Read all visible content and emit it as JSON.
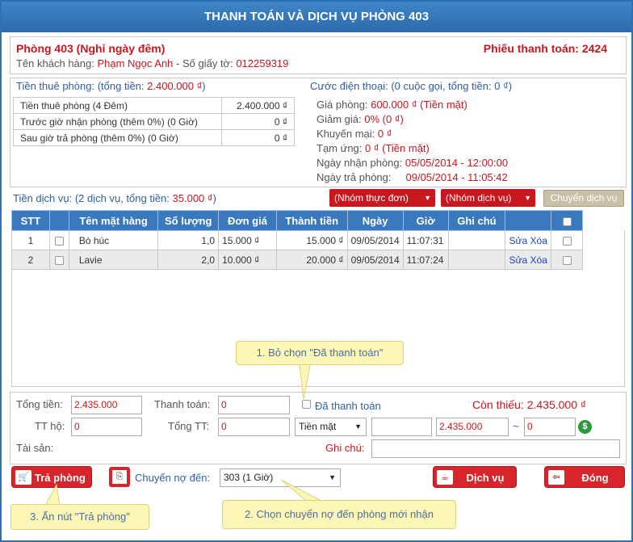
{
  "window": {
    "title": "THANH TOÁN VÀ DỊCH VỤ PHÒNG 403"
  },
  "header": {
    "room": "Phòng 403 (Nghỉ ngày đêm)",
    "bill_label": "Phiếu thanh toán: 2424",
    "customer_label": "Tên khách hàng: ",
    "customer_name": "Phạm Ngọc Anh",
    "id_label": " - Số giấy tờ: ",
    "id_number": "012259319"
  },
  "rent": {
    "heading_prefix": "Tiền thuê phòng: (tổng tiền: ",
    "heading_total": "2.400.000 ₫",
    "heading_suffix": ")",
    "rows": [
      {
        "label": "Tiền thuê phòng (4 Đêm)",
        "value": "2.400.000 ₫"
      },
      {
        "label": "Trước giờ nhận phòng (thêm 0%) (0 Giờ)",
        "value": "0 ₫"
      },
      {
        "label": "Sau giờ trả phòng (thêm 0%) (0 Giờ)",
        "value": "0 ₫"
      }
    ]
  },
  "phone": {
    "heading": "Cước điện thoại: (0 cuộc gọi, tổng tiền: 0 ₫)",
    "room_price_label": "Giá phòng: ",
    "room_price": "600.000 ₫ (Tiền mặt)",
    "discount_label": "Giảm giá: ",
    "discount": "0% (0 ₫)",
    "promo_label": "Khuyến mại: ",
    "promo": "0 ₫",
    "advance_label": "Tạm ứng: ",
    "advance": "0 ₫ (Tiền mặt)",
    "checkin_label": "Ngày nhận phòng: ",
    "checkin": "05/05/2014 - 12:00:00",
    "checkout_label": "Ngày trả phòng:",
    "checkout": "09/05/2014 - 11:05:42"
  },
  "services": {
    "heading_prefix": "Tiền dịch vụ: (2 dịch vụ, tổng tiền: ",
    "heading_total": "35.000 ₫",
    "heading_suffix": ")",
    "menu_group": "(Nhóm thực đơn)",
    "service_group": "(Nhóm dịch vụ)",
    "transfer_button": "Chuyển dịch vụ",
    "columns": [
      "STT",
      "",
      "Tên mặt hàng",
      "Số lượng",
      "Đơn giá",
      "Thành tiền",
      "Ngày",
      "Giờ",
      "Ghi chú",
      "",
      ""
    ],
    "rows": [
      {
        "stt": "1",
        "name": "Bò húc",
        "qty": "1,0",
        "price": "15.000 ₫",
        "total": "15.000 ₫",
        "date": "09/05/2014",
        "time": "11:07:31",
        "note": "",
        "edit": "Sửa",
        "delete": "Xóa"
      },
      {
        "stt": "2",
        "name": "Lavie",
        "qty": "2,0",
        "price": "10.000 ₫",
        "total": "20.000 ₫",
        "date": "09/05/2014",
        "time": "11:07:24",
        "note": "",
        "edit": "Sửa",
        "delete": "Xóa"
      }
    ]
  },
  "callouts": {
    "c1": "1. Bỏ chọn \"Đã thanh toán\"",
    "c2": "2. Chọn chuyển nợ đến phòng mới nhận",
    "c3": "3. Ấn nút \"Trả phòng\""
  },
  "totals": {
    "total_label": "Tổng tiền:",
    "total_value": "2.435.000",
    "payment_label": "Thanh toán:",
    "payment_value": "0",
    "paid_label": "Đã thanh toán",
    "remaining": "Còn thiếu: 2.435.000 ₫",
    "tt_ho_label": "TT hộ:",
    "tt_ho_value": "0",
    "tong_tt_label": "Tổng TT:",
    "tong_tt_value": "0",
    "method": "Tiền mặt",
    "field_blank": "",
    "amount_value": "2.435.000",
    "tilde": "~",
    "change_value": "0",
    "asset_label": "Tài sản:",
    "note_label": "Ghi chú:"
  },
  "footer": {
    "checkout_button": "Trả phòng",
    "debt_transfer_label": "Chuyển nợ đến:",
    "debt_transfer_value": "303 (1 Giờ)",
    "service_button": "Dịch vụ",
    "close_button": "Đóng"
  },
  "colors": {
    "accent": "#2f6fb2",
    "danger": "#d8242b",
    "callout": "#fdf7b7"
  }
}
